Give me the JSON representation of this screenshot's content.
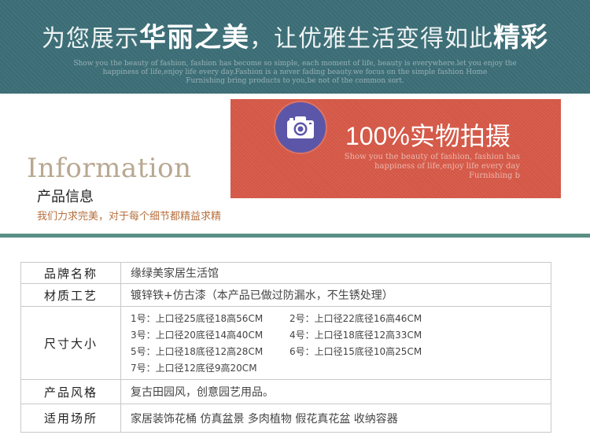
{
  "banner": {
    "title_part1": "为您展示",
    "title_emph1": "华丽之美",
    "title_part2": "，让优雅生活变得如此",
    "title_emph2": "精彩",
    "sub_lines": [
      "Show you the beauty of fashion, fashion has become so simple, each moment of life, beauty is everywhere.let you enjoy the",
      "happiness of life,enjoy life every day.Fashion is a never fading beauty.we focus on the simple fashion Home",
      "Furnishing bring products to you,be not of the common sort."
    ]
  },
  "photo": {
    "icon": "camera-icon",
    "label": "100%实物拍摄",
    "sub_lines": [
      "Show you the beauty of fashion, fashion has",
      "happiness of life,enjoy life every day",
      "Furnishing b"
    ],
    "color": "#d95a48",
    "circle_color": "#5c56a8"
  },
  "info": {
    "heading_en": "Information",
    "heading_cn": "产品信息",
    "slogan": "我们力求完美，对于每个细节都精益求精"
  },
  "specs": {
    "brand_label": "品牌名称",
    "brand_value": "缘绿美家居生活馆",
    "material_label": "材质工艺",
    "material_value": "镀锌铁+仿古漆（本产品已做过防漏水，不生锈处理）",
    "size_label": "尺寸大小",
    "sizes": [
      "1号：上口径25底径18高56CM",
      "2号：上口径22底径16高46CM",
      "3号：上口径20底径14高40CM",
      "4号：上口径18底径12高33CM",
      "5号：上口径18底径12高28CM",
      "6号：上口径15底径10高25CM",
      "7号：上口径12底径9高20CM"
    ],
    "style_label": "产品风格",
    "style_value": "复古田园风，创意园艺用品。",
    "usage_label": "适用场所",
    "usage_value": "家居装饰花桶 仿真盆景 多肉植物 假花真花盆 收纳容器"
  },
  "colors": {
    "banner": "#3d6f78",
    "divider": "#5b8f86",
    "heading_en": "#b8a891",
    "slogan": "#b76f3e"
  }
}
